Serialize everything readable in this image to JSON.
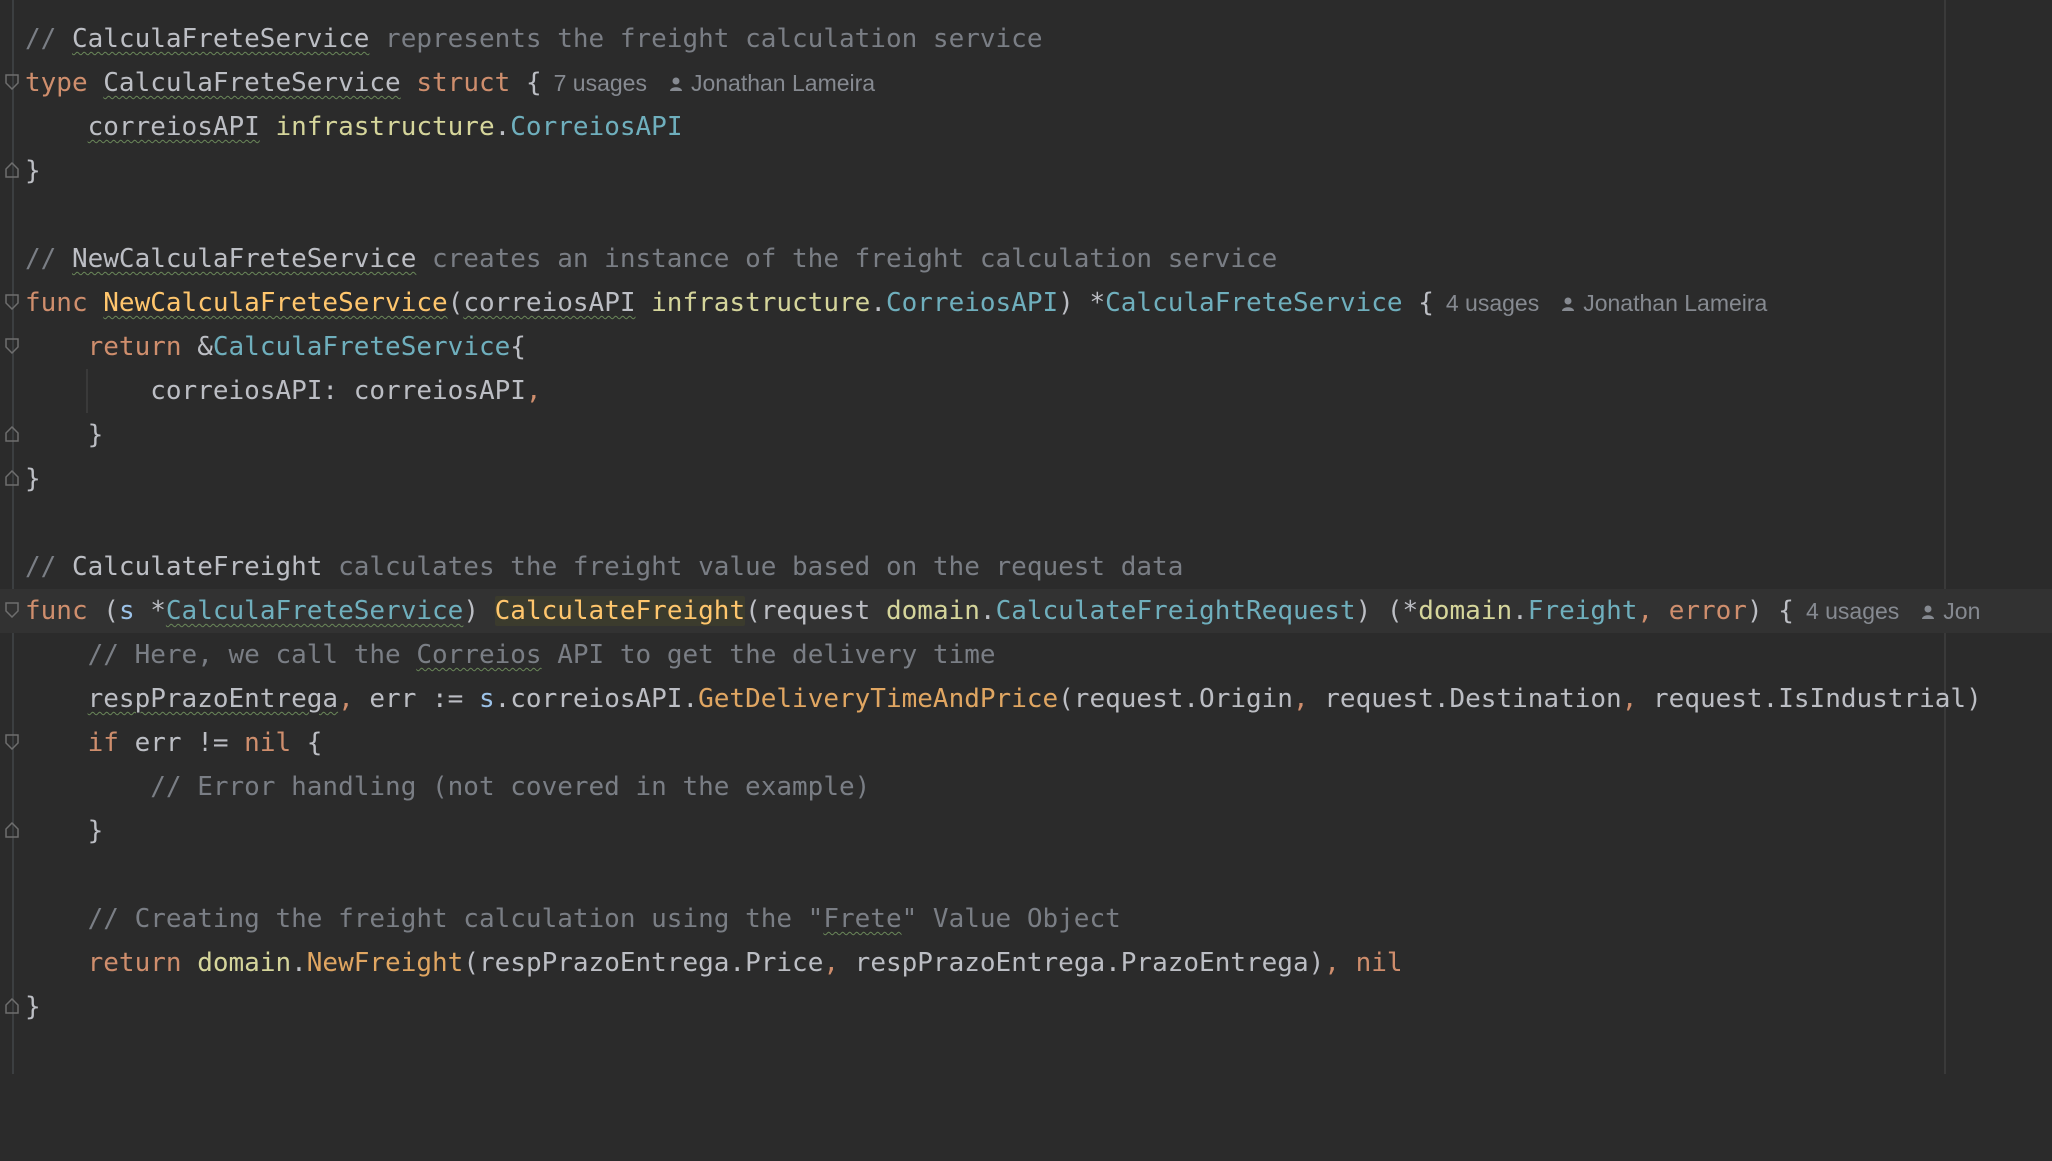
{
  "editor": {
    "language": "Go",
    "colors": {
      "background": "#2b2b2b",
      "keyword": "#cf8e6d",
      "comment": "#7a7e85",
      "function": "#ffc66d",
      "type": "#6fafbd",
      "package": "#d5d59b"
    },
    "lines": {
      "l1": {
        "comment_prefix": "// ",
        "ident": "CalculaFreteService",
        "rest": " represents the freight calculation service"
      },
      "l2": {
        "kw": "type",
        "name": "CalculaFreteService",
        "kw2": "struct",
        "brace": "{",
        "usages": "7 usages",
        "author": "Jonathan Lameira"
      },
      "l3": {
        "field": "correiosAPI",
        "pkg": "infrastructure",
        "dot": ".",
        "type": "CorreiosAPI"
      },
      "l4": {
        "brace": "}"
      },
      "l6": {
        "comment_prefix": "// ",
        "ident": "NewCalculaFreteService",
        "rest": " creates an instance of the freight calculation service"
      },
      "l7": {
        "kw": "func",
        "name": "NewCalculaFreteService",
        "open": "(",
        "param": "correiosAPI",
        "pkg": "infrastructure",
        "dot": ".",
        "ptype": "CorreiosAPI",
        "close": ")",
        "star": "*",
        "rtype": "CalculaFreteService",
        "brace": "{",
        "usages": "4 usages",
        "author": "Jonathan Lameira"
      },
      "l8": {
        "kw": "return",
        "amp": "&",
        "type": "CalculaFreteService",
        "brace": "{"
      },
      "l9": {
        "field": "correiosAPI",
        "colon": ": ",
        "value": "correiosAPI",
        "comma": ","
      },
      "l10": {
        "brace": "}"
      },
      "l11": {
        "brace": "}"
      },
      "l13": {
        "comment_prefix": "// ",
        "ident": "CalculateFreight",
        "rest": " calculates the freight value based on the request data"
      },
      "l14": {
        "kw": "func",
        "open": "(",
        "recv": "s",
        "star": "*",
        "rtype": "CalculaFreteService",
        "close": ")",
        "name": "CalculateFreight",
        "popen": "(request ",
        "pkg": "domain",
        "dot": ".",
        "ptype": "CalculateFreightRequest",
        "pclose": ") (*",
        "pkg2": "domain",
        "dot2": ".",
        "rtype2": "Freight",
        "comma": ",",
        "kw2": "error",
        "tail": ") {",
        "usages": "4 usages",
        "author": "Jon"
      },
      "l15": {
        "pre": "// Here, we call the ",
        "ident": "Correios",
        "post": " API to get the delivery time"
      },
      "l16": {
        "v1": "respPrazoEntrega",
        "c1": ",",
        "v2": " err := ",
        "recv": "s",
        "mid": ".correiosAPI.",
        "call": "GetDeliveryTimeAndPrice",
        "a1": "(request.Origin",
        "c2": ",",
        "a2": " request.Destination",
        "c3": ",",
        "a3": " request.IsIndustrial)"
      },
      "l17": {
        "kw": "if",
        "cond": " err != ",
        "nil": "nil",
        "brace": " {"
      },
      "l18": {
        "comment": "// Error handling (not covered in the example)"
      },
      "l19": {
        "brace": "}"
      },
      "l21": {
        "pre": "// Creating the freight calculation using the \"",
        "ident": "Frete",
        "post": "\" Value Object"
      },
      "l22": {
        "kw": "return",
        "pkg": "domain",
        "dot": ".",
        "call": "NewFreight",
        "args": "(respPrazoEntrega.Price",
        "comma": ",",
        "args2": " respPrazoEntrega.PrazoEntrega)",
        "comma2": ",",
        "nil": "nil"
      },
      "l23": {
        "brace": "}"
      }
    }
  }
}
